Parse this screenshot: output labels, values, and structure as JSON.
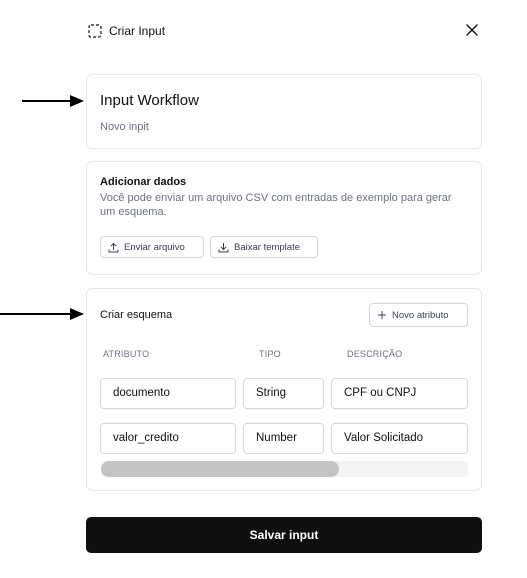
{
  "header": {
    "title": "Criar Input",
    "title_icon": "dashed-square-icon",
    "close_icon": "close-icon"
  },
  "input_card": {
    "title": "Input Workflow",
    "description": "Novo inpit"
  },
  "add_data": {
    "title": "Adicionar dados",
    "description": "Você pode enviar um arquivo CSV com entradas de exemplo para gerar um esquema.",
    "upload_label": "Enviar arquivo",
    "template_label": "Baixar template"
  },
  "schema": {
    "title": "Criar esquema",
    "new_attribute_label": "Novo atributo",
    "columns": [
      "ATRIBUTO",
      "TIPO",
      "DESCRIÇÃO"
    ],
    "rows": [
      {
        "attribute": "documento",
        "type": "String",
        "description": "CPF ou CNPJ"
      },
      {
        "attribute": "valor_credito",
        "type": "Number",
        "description": "Valor Solicitado"
      }
    ]
  },
  "footer": {
    "save_label": "Salvar input"
  },
  "colors": {
    "primary_button": "#0f0f0f",
    "border": "#e5e7eb",
    "muted_text": "#6b7280"
  }
}
